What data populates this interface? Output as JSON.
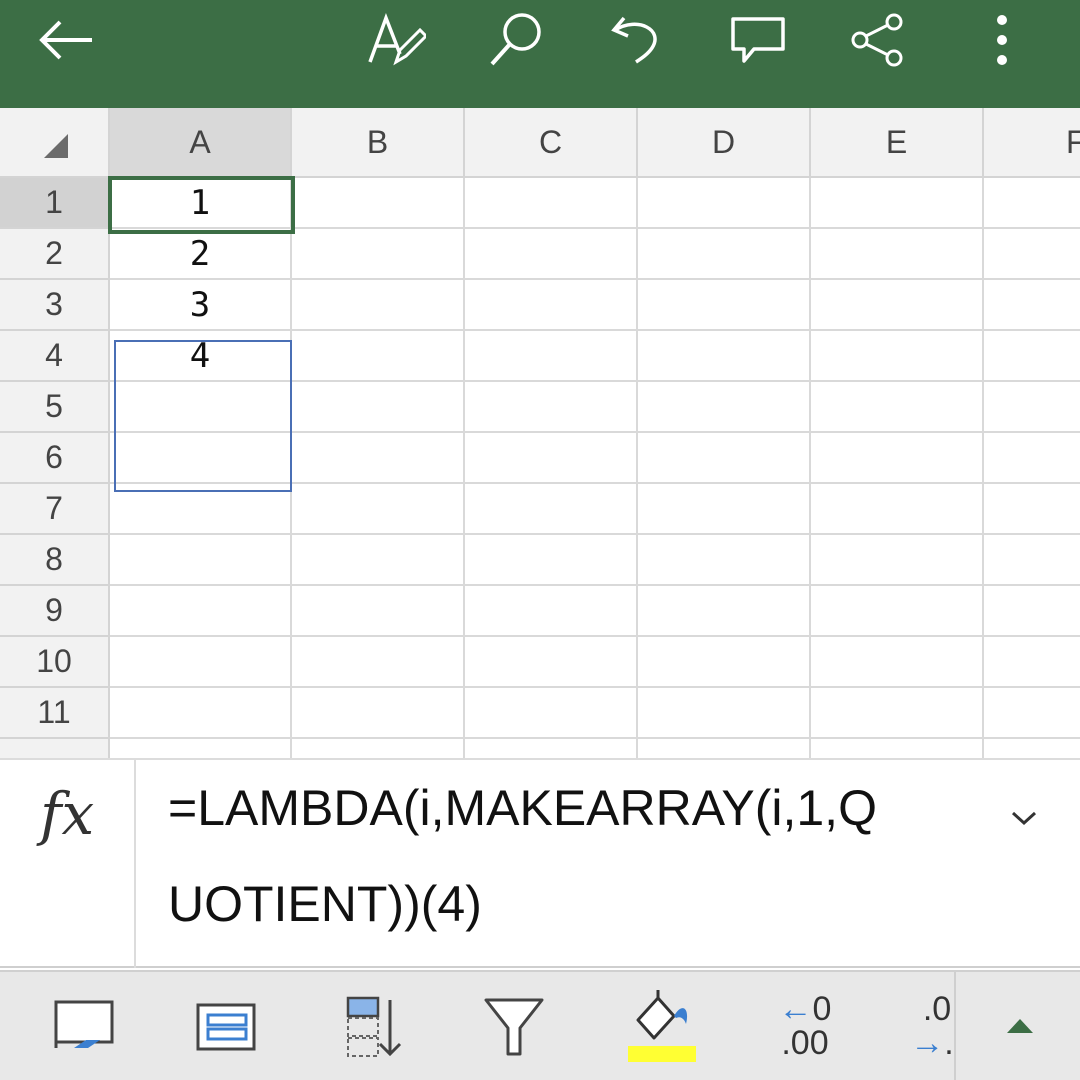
{
  "colors": {
    "accent": "#3c6e45",
    "spill_border": "#4a6fb5",
    "fill_highlight": "#ffff33"
  },
  "toolbar": {
    "icons": [
      "back-arrow-icon",
      "edit-pen-icon",
      "search-icon",
      "undo-icon",
      "comment-icon",
      "share-icon",
      "more-vert-icon"
    ]
  },
  "grid": {
    "columns": [
      "A",
      "B",
      "C",
      "D",
      "E",
      "F"
    ],
    "rows": [
      "1",
      "2",
      "3",
      "4",
      "5",
      "6",
      "7",
      "8",
      "9",
      "10",
      "11"
    ],
    "cells": {
      "A1": "1",
      "A2": "2",
      "A3": "3",
      "A4": "4"
    },
    "active_cell": "A1"
  },
  "formula_bar": {
    "label": "fx",
    "text": "=LAMBDA(i,MAKEARRAY(i,1,QUOTIENT))(4)"
  },
  "ribbon": {
    "decrease_decimal": {
      "top": "←.0",
      "bottom": ".00"
    },
    "increase_decimal": {
      "top": ".0",
      "bottom": "→."
    },
    "icons": [
      "freeze-panes-icon",
      "format-table-icon",
      "sort-icon",
      "filter-icon",
      "fill-color-icon",
      "decrease-decimal-icon",
      "increase-decimal-icon",
      "collapse-ribbon-icon"
    ]
  }
}
